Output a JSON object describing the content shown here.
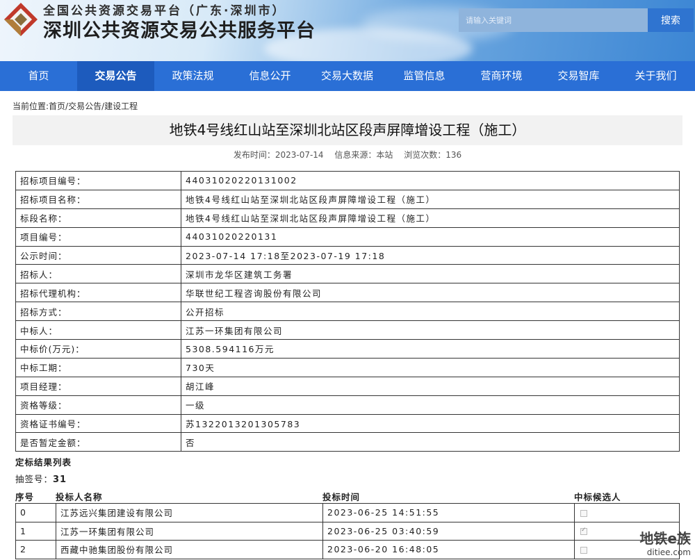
{
  "header": {
    "top_title": "全国公共资源交易平台（广东·深圳市）",
    "main_title": "深圳公共资源交易公共服务平台",
    "search_placeholder": "请输入关键词",
    "search_button": "搜索"
  },
  "nav": [
    {
      "label": "首页",
      "active": false
    },
    {
      "label": "交易公告",
      "active": true
    },
    {
      "label": "政策法规",
      "active": false
    },
    {
      "label": "信息公开",
      "active": false
    },
    {
      "label": "交易大数据",
      "active": false
    },
    {
      "label": "监管信息",
      "active": false
    },
    {
      "label": "营商环境",
      "active": false
    },
    {
      "label": "交易智库",
      "active": false
    },
    {
      "label": "关于我们",
      "active": false
    }
  ],
  "breadcrumb": "当前位置:首页/交易公告/建设工程",
  "article": {
    "title": "地铁4号线红山站至深圳北站区段声屏障增设工程（施工）",
    "publish_time": "发布时间：2023-07-14",
    "source": "信息来源：本站",
    "views": "浏览次数：136"
  },
  "info_rows": [
    {
      "key": "招标项目编号：",
      "value": "44031020220131002"
    },
    {
      "key": "招标项目名称：",
      "value": "地铁4号线红山站至深圳北站区段声屏障增设工程（施工）"
    },
    {
      "key": "标段名称：",
      "value": "地铁4号线红山站至深圳北站区段声屏障增设工程（施工）"
    },
    {
      "key": "项目编号：",
      "value": "44031020220131"
    },
    {
      "key": "公示时间：",
      "value": "2023-07-14 17:18至2023-07-19 17:18"
    },
    {
      "key": "招标人：",
      "value": "深圳市龙华区建筑工务署"
    },
    {
      "key": "招标代理机构：",
      "value": "华联世纪工程咨询股份有限公司"
    },
    {
      "key": "招标方式：",
      "value": "公开招标"
    },
    {
      "key": "中标人：",
      "value": "江苏一环集团有限公司"
    },
    {
      "key": "中标价(万元)：",
      "value": "5308.594116万元"
    },
    {
      "key": "中标工期：",
      "value": "730天"
    },
    {
      "key": "项目经理：",
      "value": "胡江峰"
    },
    {
      "key": "资格等级：",
      "value": "一级"
    },
    {
      "key": "资格证书编号：",
      "value": "苏1322013201305783"
    },
    {
      "key": "是否暂定金额：",
      "value": "否"
    }
  ],
  "results": {
    "section_title": "定标结果列表",
    "lottery_label": "抽签号：",
    "lottery_value": "31",
    "headers": {
      "no": "序号",
      "name": "投标人名称",
      "time": "投标时间",
      "candidate": "中标候选人"
    },
    "rows": [
      {
        "no": "0",
        "name": "江苏远兴集团建设有限公司",
        "time": "2023-06-25 14:51:55",
        "candidate": false
      },
      {
        "no": "1",
        "name": "江苏一环集团有限公司",
        "time": "2023-06-25 03:40:59",
        "candidate": true
      },
      {
        "no": "2",
        "name": "西藏中驰集团股份有限公司",
        "time": "2023-06-20 16:48:05",
        "candidate": false
      }
    ]
  },
  "watermark": {
    "line1": "地铁e族",
    "line2": "ditiee.com"
  },
  "colors": {
    "nav": "#2a6fd6",
    "nav_active": "#1d5bbd",
    "search_button": "#2f74d0"
  }
}
